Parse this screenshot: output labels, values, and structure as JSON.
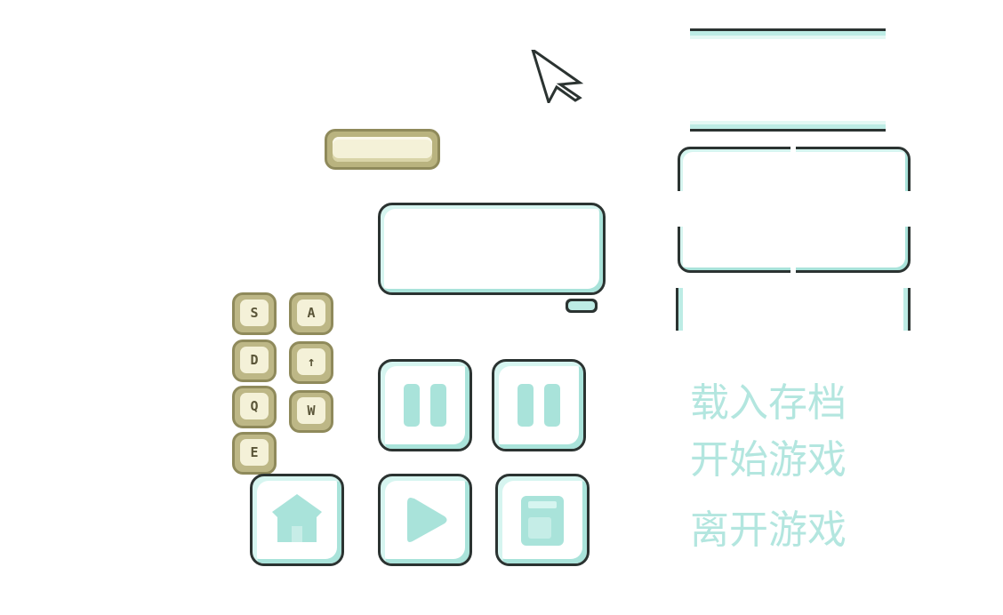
{
  "menu": {
    "load_save": "载入存档",
    "start_game": "开始游戏",
    "quit_game": "离开游戏"
  },
  "keys": {
    "left_column": [
      "S",
      "D",
      "Q",
      "E"
    ],
    "right_column": [
      "A",
      "↑",
      "W"
    ]
  },
  "icons": {
    "cursor": "arrow-cursor-icon",
    "pause_1": "pause-icon",
    "pause_2": "pause-icon",
    "home": "home-icon",
    "play": "play-icon",
    "save": "save-icon"
  },
  "colors": {
    "mint_light": "#d6f5f0",
    "mint": "#bdece5",
    "mint_dark": "#a9e3da",
    "outline": "#2b3331",
    "tan": "#bdb786",
    "tan_border": "#8f8a5b",
    "cream": "#f4f1d8",
    "menu_text": "#b3e6df"
  }
}
